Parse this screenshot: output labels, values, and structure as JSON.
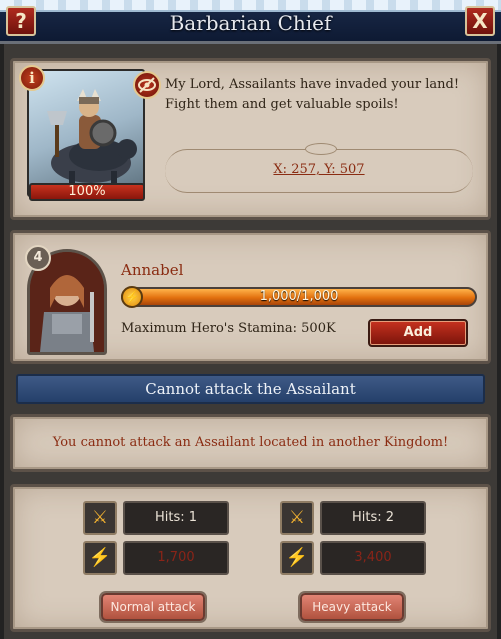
{
  "window": {
    "title": "Barbarian Chief",
    "help_label": "?",
    "close_label": "X"
  },
  "boss": {
    "info_label": "i",
    "health_text": "100%",
    "message": "My Lord, Assailants have invaded your land! Fight them and get valuable spoils!",
    "coordinates": "X: 257, Y: 507"
  },
  "hero": {
    "level": "4",
    "name": "Annabel",
    "stamina_text": "1,000/1,000",
    "stamina_fraction": 1.0,
    "stamina_label": "Maximum Hero's Stamina: 500K",
    "add_label": "Add"
  },
  "status": {
    "banner": "Cannot attack the Assailant",
    "message": "You cannot attack an Assailant located in another Kingdom!"
  },
  "attacks": {
    "normal": {
      "hits": "Hits: 1",
      "damage": "1,700",
      "label": "Normal attack"
    },
    "heavy": {
      "hits": "Hits: 2",
      "damage": "3,400",
      "label": "Heavy attack"
    }
  },
  "icons": {
    "hits": "crossed-swords-icon",
    "damage": "stamina-bolt-icon"
  },
  "colors": {
    "title_bar": "#0e1a33",
    "parchment": "#d8cbbc",
    "accent_red": "#8a2c12",
    "stamina_orange": "#e2700e",
    "banner_blue": "#2d4a77"
  }
}
